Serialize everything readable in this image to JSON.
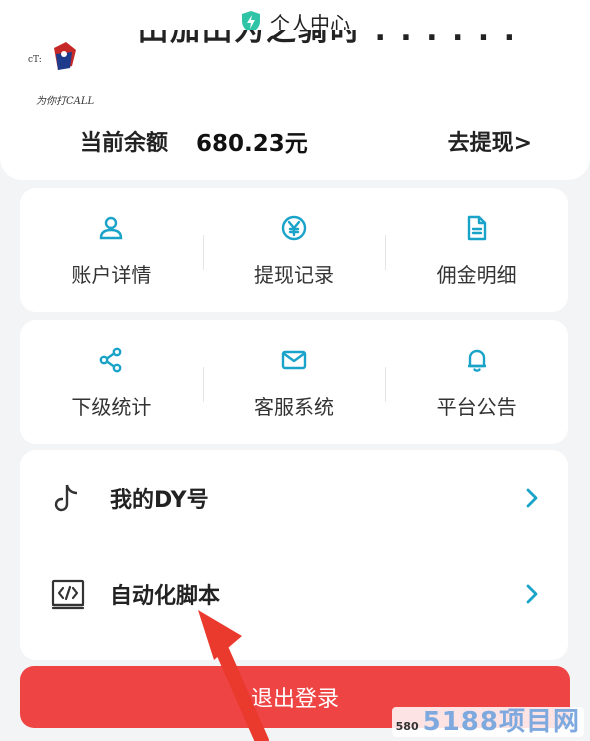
{
  "header": {
    "title": "个人中心",
    "shield_icon": "shield-icon",
    "shield_color": "#2fc4a5"
  },
  "profile": {
    "avatar_caption": "为你打CALL",
    "username": "田加田为之骑时 . . . . . .",
    "balance_label": "当前余额",
    "balance_value": "680.23元",
    "withdraw_label": "去提现>"
  },
  "menu_row1": [
    {
      "label": "账户详情",
      "icon": "user-icon"
    },
    {
      "label": "提现记录",
      "icon": "yen-icon"
    },
    {
      "label": "佣金明细",
      "icon": "document-icon"
    }
  ],
  "menu_row2": [
    {
      "label": "下级统计",
      "icon": "share-icon"
    },
    {
      "label": "客服系统",
      "icon": "mail-icon"
    },
    {
      "label": "平台公告",
      "icon": "bell-icon"
    }
  ],
  "list": [
    {
      "label": "我的DY号",
      "icon": "tiktok-icon"
    },
    {
      "label": "自动化脚本",
      "icon": "code-icon"
    }
  ],
  "logout_label": "退出登录",
  "watermark": {
    "small": "580",
    "big": "5188项目网"
  },
  "colors": {
    "accent": "#1aa3c9",
    "danger": "#ef4444",
    "arrow": "#ea3a2e"
  }
}
